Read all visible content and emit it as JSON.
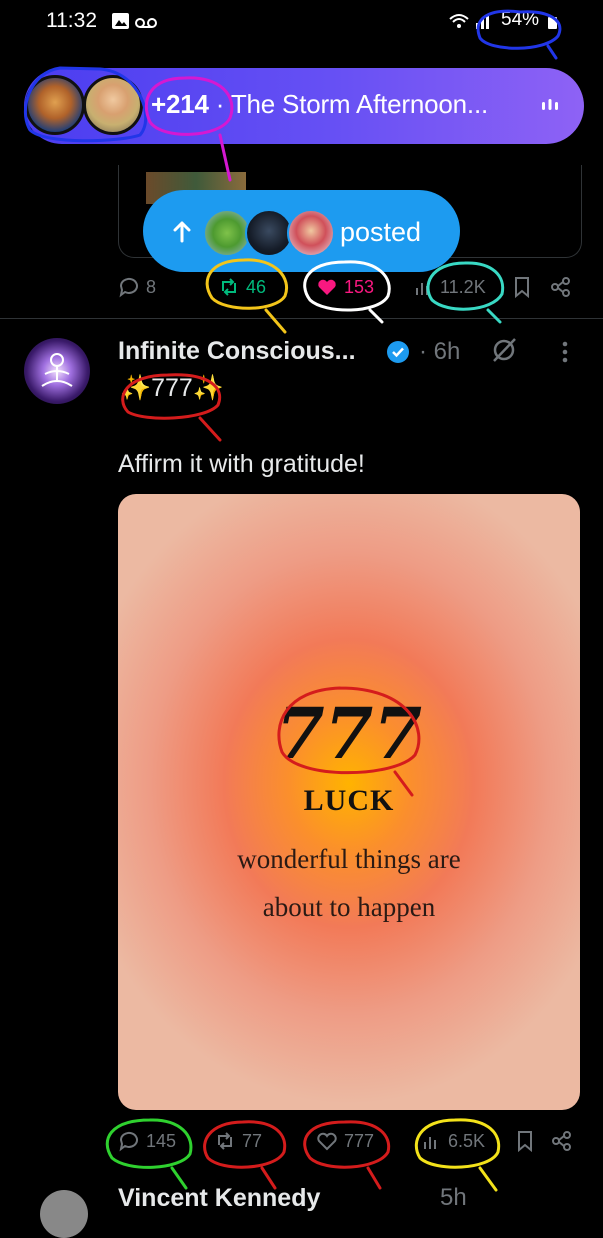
{
  "status_bar": {
    "time": "11:32",
    "battery": "54%"
  },
  "spaces": {
    "count": "+214",
    "separator": "·",
    "title": "The Storm Afternoon..."
  },
  "posted_pill": {
    "label": "posted"
  },
  "prev_post": {
    "replies": "8",
    "reposts": "46",
    "likes": "153",
    "views": "11.2K"
  },
  "post": {
    "author": "Infinite Conscious...",
    "time": "· 6h",
    "text_line1": "✨777✨",
    "text_line2": "Affirm it with gratitude!",
    "image": {
      "number": "777",
      "heading": "LUCK",
      "line1": "wonderful things are",
      "line2": "about to happen"
    },
    "replies": "145",
    "reposts": "77",
    "likes": "777",
    "views": "6.5K"
  },
  "next_post": {
    "author": "Vincent Kennedy",
    "time": "5h"
  },
  "colors": {
    "background": "#000000",
    "spaces_gradient_start": "#4b3df0",
    "spaces_gradient_end": "#8e62f5",
    "posted_pill": "#1d9bf0",
    "repost_green": "#00ba7c",
    "like_pink": "#f91880",
    "muted": "#71767b",
    "verified": "#1d9bf0"
  }
}
